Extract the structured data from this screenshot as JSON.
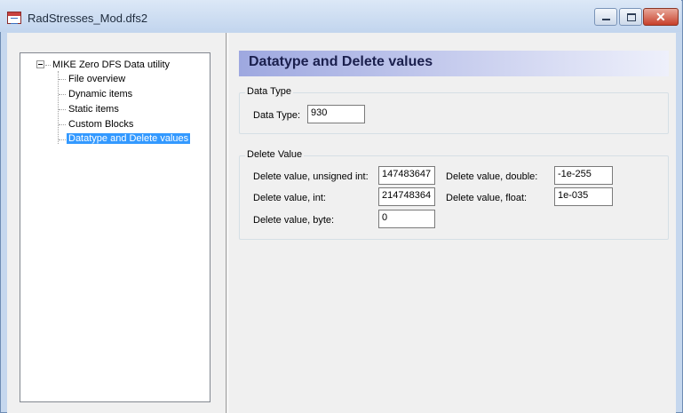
{
  "window": {
    "title": "RadStresses_Mod.dfs2",
    "icon": "dfs-file-icon",
    "controls": {
      "minimize": "—",
      "maximize": "□",
      "close": "✕"
    }
  },
  "tree": {
    "root": "MIKE Zero DFS Data utility",
    "items": [
      "File overview",
      "Dynamic items",
      "Static items",
      "Custom Blocks",
      "Datatype and Delete values"
    ],
    "selected": "Datatype and Delete values"
  },
  "panel": {
    "header": "Datatype and Delete values",
    "data_type_group": {
      "caption": "Data Type",
      "label": "Data Type:",
      "value": "930"
    },
    "delete_value_group": {
      "caption": "Delete Value",
      "unsigned_int_label": "Delete value, unsigned int:",
      "unsigned_int_value": "147483647",
      "int_label": "Delete value, int:",
      "int_value": "214748364",
      "byte_label": "Delete value, byte:",
      "byte_value": "0",
      "double_label": "Delete value, double:",
      "double_value": "-1e-255",
      "float_label": "Delete value, float:",
      "float_value": "1e-035"
    }
  }
}
